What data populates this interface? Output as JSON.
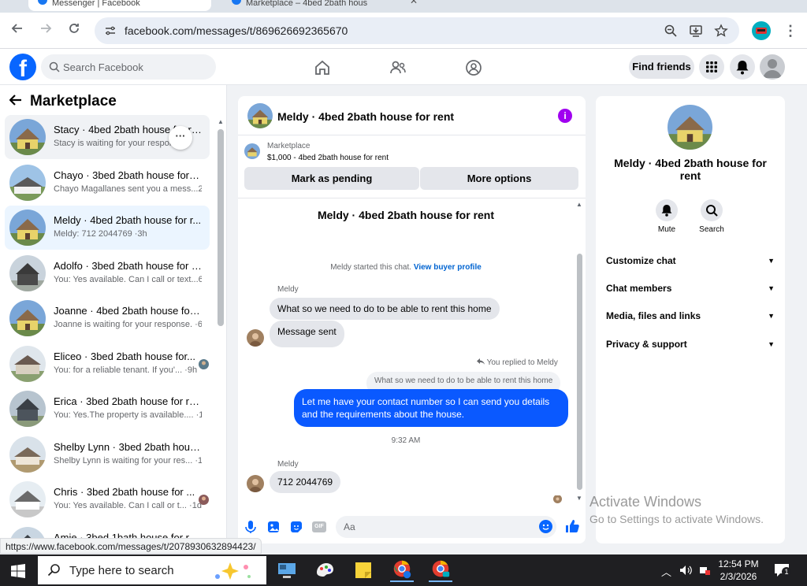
{
  "browser": {
    "tabs": [
      {
        "title": "Messenger | Facebook"
      },
      {
        "title": "Marketplace – 4bed 2bath hous"
      }
    ],
    "url": "facebook.com/messages/t/869626692365670",
    "status_url": "https://www.facebook.com/messages/t/2078930632894423/"
  },
  "fb_header": {
    "logo_letter": "f",
    "search_placeholder": "Search Facebook",
    "find_friends": "Find friends"
  },
  "left": {
    "title": "Marketplace",
    "chats": [
      {
        "name": "Stacy · 4bed 2bath house for rent",
        "snippet": "Stacy is waiting for your response.",
        "time": ""
      },
      {
        "name": "Chayo · 3bed 2bath house for r...",
        "snippet": "Chayo Magallanes sent you a mess...",
        "time": "2h"
      },
      {
        "name": "Meldy · 4bed 2bath house for r...",
        "snippet": "Meldy: 712 2044769 ·",
        "time": "3h"
      },
      {
        "name": "Adolfo · 3bed 2bath house for r...",
        "snippet": "You: Yes available. Can I call or text...",
        "time": "6h"
      },
      {
        "name": "Joanne · 4bed 2bath house for r...",
        "snippet": "Joanne is waiting for your response. ·",
        "time": "6h"
      },
      {
        "name": "Eliceo · 3bed 2bath house for...",
        "snippet": "You: for a reliable tenant. If you'... ·",
        "time": "9h"
      },
      {
        "name": "Erica · 3bed 2bath house for rent",
        "snippet": "You: Yes.The property is available.... ·",
        "time": "12h"
      },
      {
        "name": "Shelby Lynn · 3bed 2bath house...",
        "snippet": "Shelby Lynn is waiting for your res... ·",
        "time": "1d"
      },
      {
        "name": "Chris · 3bed 2bath house for ...",
        "snippet": "You: Yes available. Can I call or t... ·",
        "time": "1d"
      },
      {
        "name": "Amie · 3bed 1bath house for r...",
        "snippet": "",
        "time": ""
      }
    ],
    "more_button": "···"
  },
  "chat": {
    "title": "Meldy · 4bed 2bath house for rent",
    "info_glyph": "i",
    "marketplace_label": "Marketplace",
    "listing": "$1,000 - 4bed 2bath house for rent",
    "mark_pending": "Mark as pending",
    "more_options": "More options",
    "conversation_name": "Meldy · 4bed 2bath house for rent",
    "started_text": "Meldy started this chat.",
    "view_profile": "View buyer profile",
    "sender": "Meldy",
    "msg1": "What so we need to do to be able to rent this home",
    "msg2": "Message sent",
    "replied_to": "You replied to Meldy",
    "quoted": "What so we need to do to be able to rent this home",
    "reply": "Let me have your contact number so I can send you details and the requirements about the house.",
    "time": "9:32 AM",
    "sender2": "Meldy",
    "msg3": "712 2044769",
    "composer_placeholder": "Aa",
    "gif_label": "GIF"
  },
  "info": {
    "name": "Meldy · 4bed 2bath house for rent",
    "mute": "Mute",
    "search": "Search",
    "rows": [
      "Customize chat",
      "Chat members",
      "Media, files and links",
      "Privacy & support"
    ]
  },
  "watermark": {
    "line1": "Activate Windows",
    "line2": "Go to Settings to activate Windows."
  },
  "taskbar": {
    "search_placeholder": "Type here to search",
    "time": "12:54 PM",
    "date": "2/3/2026",
    "notification_count": "1"
  },
  "colors": {
    "fb_blue": "#0866ff",
    "messenger_out": "#0a59ff",
    "info_purple": "#a000f0"
  }
}
